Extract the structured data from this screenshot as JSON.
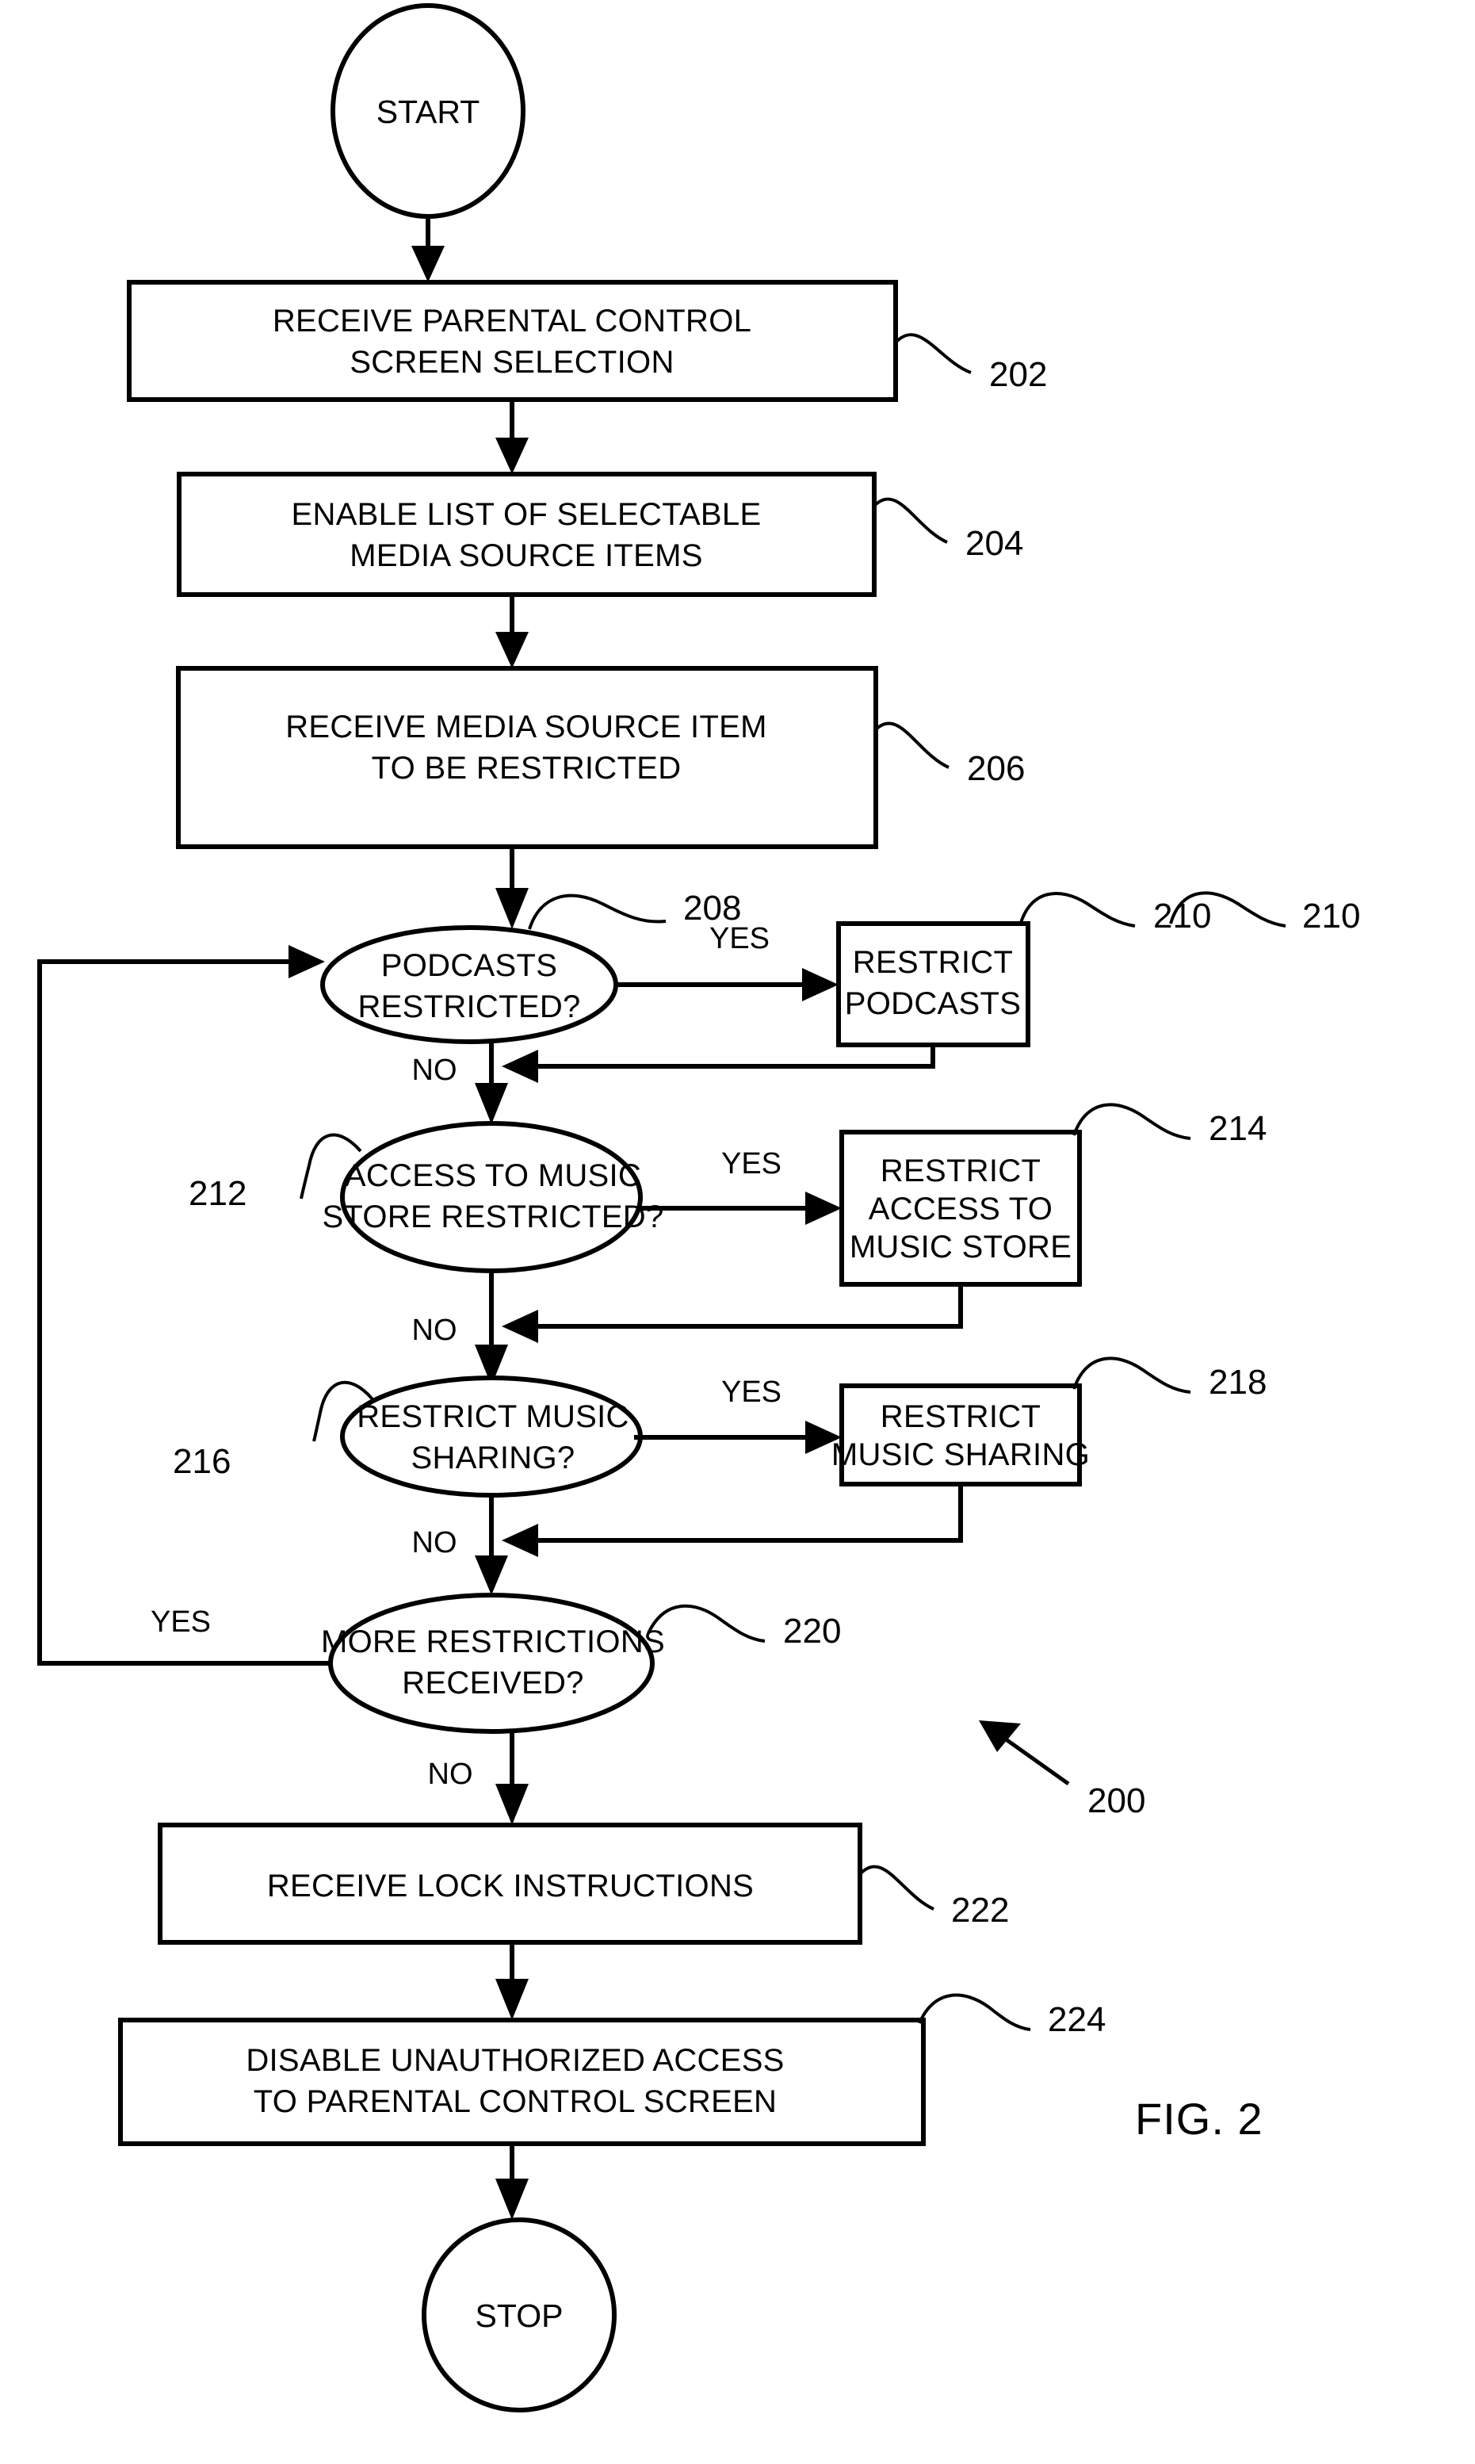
{
  "figure": {
    "label": "FIG. 2",
    "overall_ref": "200"
  },
  "terminators": {
    "start": "START",
    "stop": "STOP"
  },
  "nodes": [
    {
      "ref": "202",
      "type": "process",
      "line1": "RECEIVE PARENTAL CONTROL",
      "line2": "SCREEN SELECTION",
      "line3": ""
    },
    {
      "ref": "204",
      "type": "process",
      "line1": "ENABLE LIST OF SELECTABLE",
      "line2": "MEDIA SOURCE ITEMS",
      "line3": ""
    },
    {
      "ref": "206",
      "type": "process",
      "line1": "RECEIVE MEDIA SOURCE ITEM",
      "line2": "TO BE RESTRICTED",
      "line3": ""
    },
    {
      "ref": "208",
      "type": "decision",
      "line1": "PODCASTS",
      "line2": "RESTRICTED?",
      "line3": ""
    },
    {
      "ref": "210",
      "type": "process",
      "line1": "RESTRICT",
      "line2": "PODCASTS",
      "line3": ""
    },
    {
      "ref": "212",
      "type": "decision",
      "line1": "ACCESS TO MUSIC",
      "line2": "STORE RESTRICTED?",
      "line3": ""
    },
    {
      "ref": "214",
      "type": "process",
      "line1": "RESTRICT",
      "line2": "ACCESS TO",
      "line3": "MUSIC STORE"
    },
    {
      "ref": "216",
      "type": "decision",
      "line1": "RESTRICT MUSIC",
      "line2": "SHARING?",
      "line3": ""
    },
    {
      "ref": "218",
      "type": "process",
      "line1": "RESTRICT",
      "line2": "MUSIC SHARING",
      "line3": ""
    },
    {
      "ref": "220",
      "type": "decision",
      "line1": "MORE RESTRICTIONS",
      "line2": "RECEIVED?",
      "line3": ""
    },
    {
      "ref": "222",
      "type": "process",
      "line1": "RECEIVE LOCK INSTRUCTIONS",
      "line2": "",
      "line3": ""
    },
    {
      "ref": "224",
      "type": "process",
      "line1": "DISABLE UNAUTHORIZED ACCESS",
      "line2": "TO PARENTAL CONTROL SCREEN",
      "line3": ""
    }
  ],
  "branch_labels": {
    "yes_208": "YES",
    "no_208": "NO",
    "yes_212": "YES",
    "no_212": "NO",
    "yes_216": "YES",
    "no_216": "NO",
    "yes_220": "YES",
    "no_220": "NO"
  },
  "colors": {
    "stroke": "#000000",
    "fill": "#ffffff",
    "background": "#ffffff"
  }
}
